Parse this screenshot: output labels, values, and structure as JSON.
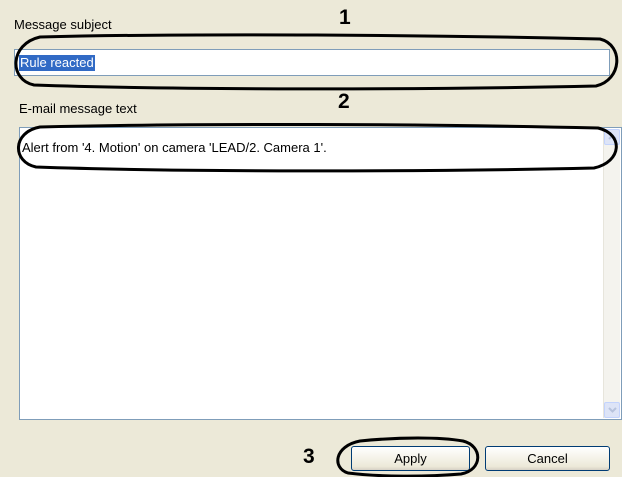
{
  "subject": {
    "label": "Message subject",
    "value": "Rule reacted"
  },
  "message": {
    "label": "E-mail message text",
    "value": "Alert from '4. Motion' on camera 'LEAD/2. Camera 1'."
  },
  "buttons": {
    "apply": "Apply",
    "cancel": "Cancel"
  },
  "callouts": {
    "one": "1",
    "two": "2",
    "three": "3"
  },
  "colors": {
    "dialog_bg": "#ece9d8",
    "selection": "#316ac5",
    "field_border": "#7f9db9"
  }
}
